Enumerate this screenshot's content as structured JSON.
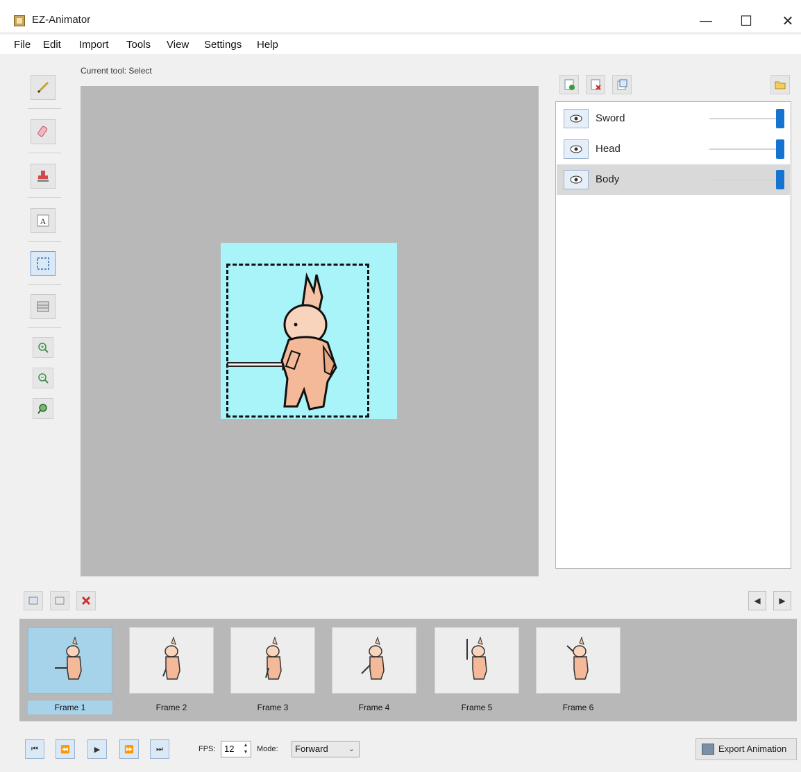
{
  "window": {
    "title": "EZ-Animator",
    "minimize": "—",
    "maximize": "☐",
    "close": "✕"
  },
  "menu": [
    "File",
    "Edit",
    "Import",
    "Tools",
    "View",
    "Settings",
    "Help"
  ],
  "status": {
    "current_tool": "Current tool: Select"
  },
  "tools": [
    {
      "name": "pencil",
      "icon": "pencil-icon"
    },
    {
      "name": "eraser",
      "icon": "eraser-icon"
    },
    {
      "name": "stamp",
      "icon": "stamp-icon"
    },
    {
      "name": "text",
      "icon": "text-icon",
      "glyph": "A"
    },
    {
      "name": "select",
      "icon": "select-icon",
      "active": true
    },
    {
      "name": "grid",
      "icon": "grid-icon"
    },
    {
      "name": "zoom-in",
      "icon": "zoom-in-icon"
    },
    {
      "name": "zoom-out",
      "icon": "zoom-out-icon"
    },
    {
      "name": "zoom-reset",
      "icon": "zoom-reset-icon"
    }
  ],
  "layers": [
    {
      "name": "Sword",
      "visible": true,
      "opacity": 1.0,
      "selected": false
    },
    {
      "name": "Head",
      "visible": true,
      "opacity": 1.0,
      "selected": false
    },
    {
      "name": "Body",
      "visible": true,
      "opacity": 1.0,
      "selected": true
    }
  ],
  "frames": [
    {
      "label": "Frame 1",
      "selected": true
    },
    {
      "label": "Frame 2",
      "selected": false
    },
    {
      "label": "Frame 3",
      "selected": false
    },
    {
      "label": "Frame 4",
      "selected": false
    },
    {
      "label": "Frame 5",
      "selected": false
    },
    {
      "label": "Frame 6",
      "selected": false
    }
  ],
  "frame_nav": {
    "prev": "◀",
    "next": "▶"
  },
  "playback": {
    "first": "⏮",
    "prev": "⏪",
    "play": "▶",
    "next": "⏩",
    "last": "⏭",
    "fps_label": "FPS:",
    "fps_value": "12",
    "mode_label": "Mode:",
    "mode_value": "Forward"
  },
  "export": {
    "label": "Export Animation"
  },
  "colors": {
    "canvas_bg": "#b8b8b8",
    "sprite_bg": "#a8f4f8",
    "accent": "#1674d1",
    "frame_selected": "#a6d2ea"
  }
}
